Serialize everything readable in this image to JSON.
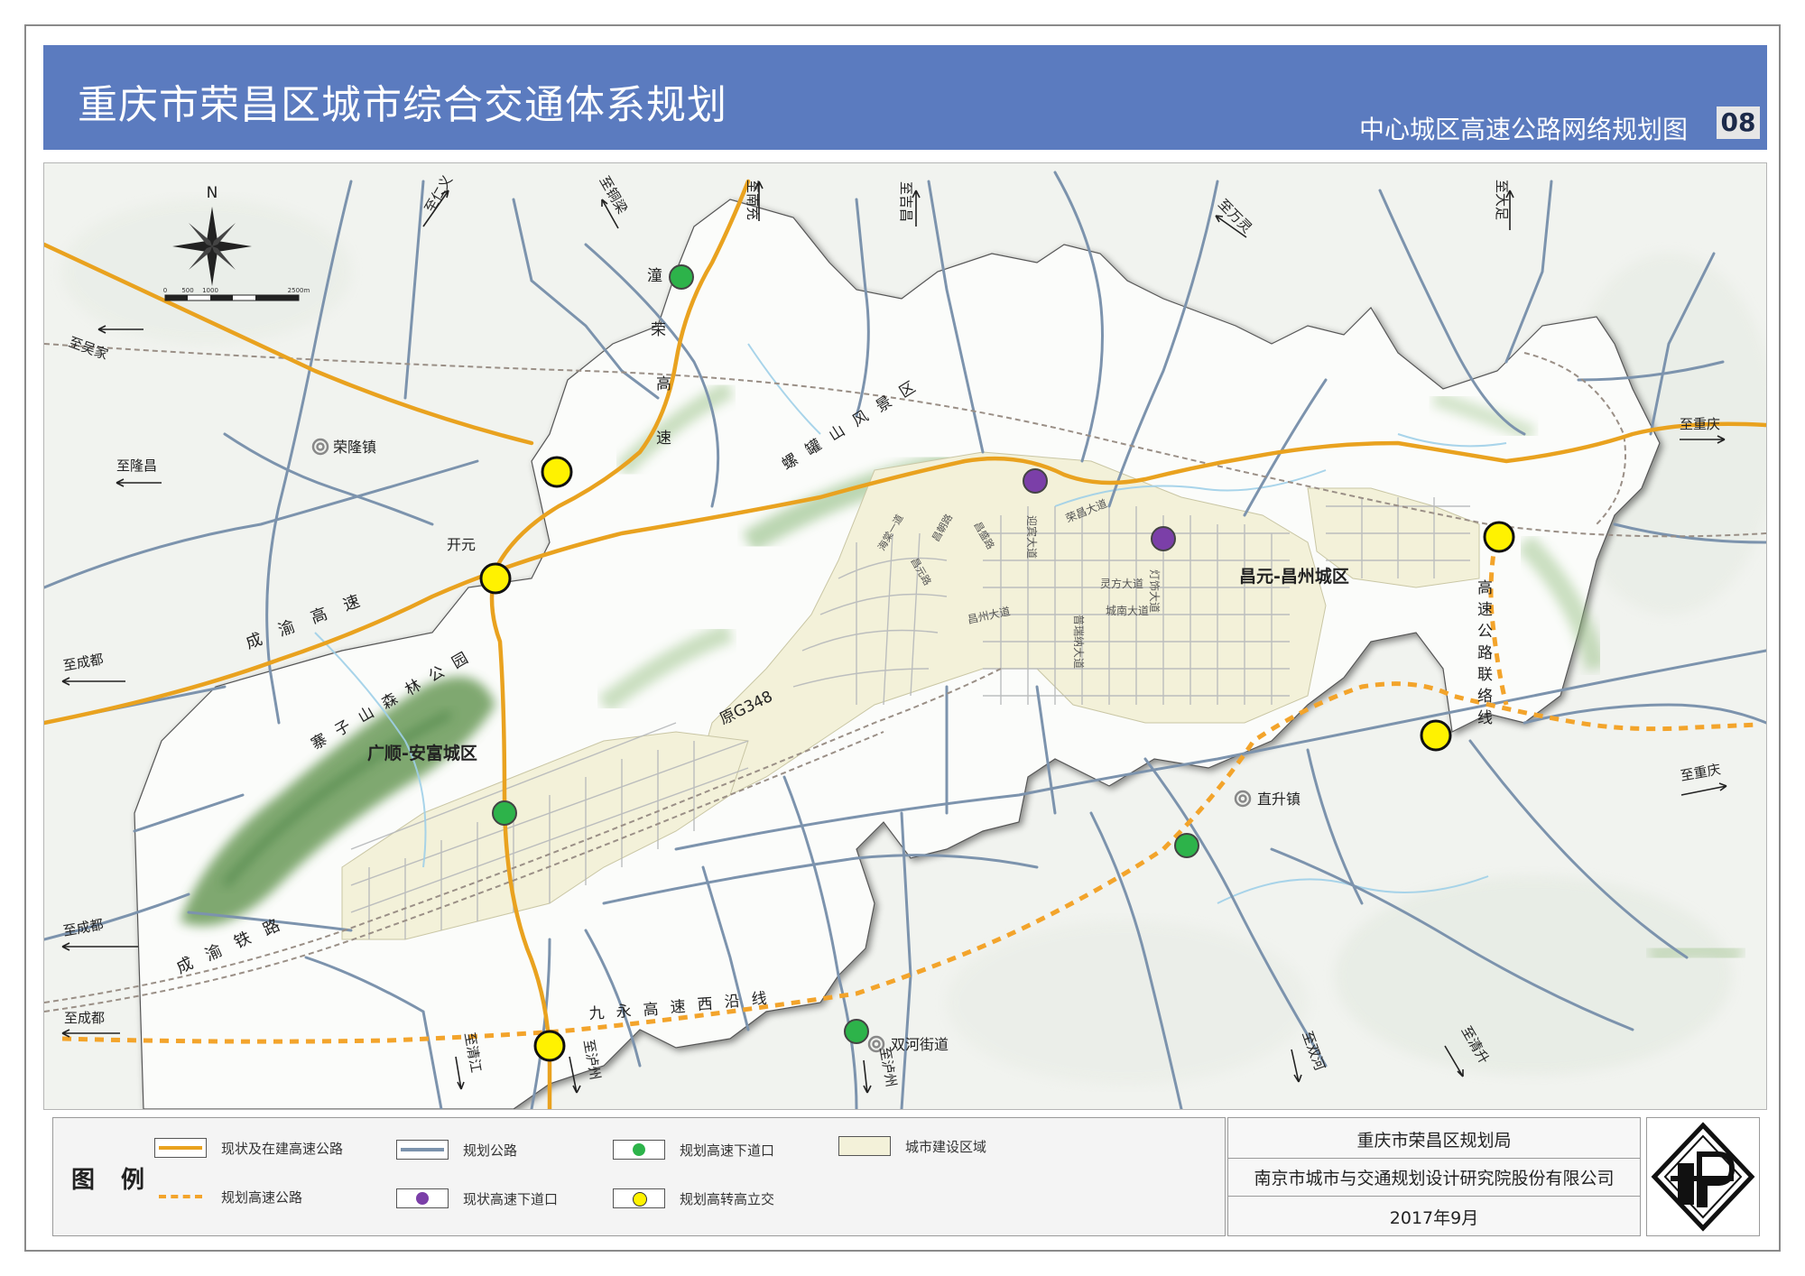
{
  "header": {
    "title": "重庆市荣昌区城市综合交通体系规划",
    "subtitle": "中心城区高速公路网络规划图",
    "sheet_number": "08"
  },
  "colors": {
    "header_bg": "#5b7bbf",
    "existing_expressway": "#e9a21f",
    "planned_expressway": "#f3a42b",
    "planned_road": "#7c93ad",
    "existing_interchange": "#7b3fa8",
    "planned_interchange": "#2db34a",
    "planned_hub_interchange": "#fff200",
    "urban_area": "#f3f1d9",
    "railway": "#9a8f86"
  },
  "map": {
    "compass_label": "N",
    "scale_labels": [
      "0",
      "500",
      "1000",
      "2500m"
    ],
    "directions": {
      "to_renyi": "至仁义",
      "to_tongliang": "至铜梁",
      "to_nanchong": "至南充",
      "to_jichang": "至吉昌",
      "to_wanling": "至万灵",
      "to_dazu": "至大足",
      "to_wujia": "至吴家",
      "to_longchang": "至隆昌",
      "to_chongqing_1": "至重庆",
      "to_chengdu_1": "至成都",
      "to_chongqing_2": "至重庆",
      "to_chengdu_2": "至成都",
      "to_chengdu_3": "至成都",
      "to_qingjiang": "至清江",
      "to_luzhou_1": "至泸州",
      "to_luzhou_2": "至泸州",
      "to_shuanghe": "至双河",
      "to_qinggang": "至清升"
    },
    "places": {
      "ronglong": "荣隆镇",
      "kaiyuan": "开元",
      "zhisheng": "直升镇",
      "shuanghe": "双河街道"
    },
    "districts": {
      "changyuan": "昌元-昌州城区",
      "guangshun": "广顺-安富城区"
    },
    "road_labels": {
      "tongrong": [
        "潼",
        "荣",
        "高",
        "速"
      ],
      "chengyu_exp": [
        "成",
        "渝",
        "高",
        "速"
      ],
      "chengyu_rail": [
        "成",
        "渝",
        "铁",
        "路"
      ],
      "jiuyong": [
        "九",
        "永",
        "高",
        "速",
        "西",
        "沿",
        "线"
      ],
      "link_line": [
        "高",
        "速",
        "公",
        "路",
        "联",
        "络",
        "线"
      ],
      "luoguan": [
        "螺",
        "罐",
        "山",
        "风",
        "景",
        "区"
      ],
      "zhaizi": [
        "寨",
        "子",
        "山",
        "森",
        "林",
        "公",
        "园"
      ],
      "g348": "原G348",
      "yingbin": "迎宾大道",
      "rongchang": "荣昌大道",
      "dengshi": "灯饰大道",
      "lingfang": "灵方大道",
      "chengnan": "城南大道",
      "puruina": "普瑞纳大道",
      "changzhou": "昌州大道",
      "haitang1": "海棠一道",
      "road_a": "昌朝路",
      "road_b": "昌元路",
      "road_c": "昌盛路"
    }
  },
  "legend": {
    "title": "图 例",
    "items": [
      {
        "label": "现状及在建高速公路"
      },
      {
        "label": "规划公路"
      },
      {
        "label": "规划高速下道口"
      },
      {
        "label": "城市建设区域"
      },
      {
        "label": "规划高速公路"
      },
      {
        "label": "现状高速下道口"
      },
      {
        "label": "规划高转高立交"
      }
    ]
  },
  "credits": {
    "org1": "重庆市荣昌区规划局",
    "org2": "南京市城市与交通规划设计研究院股份有限公司",
    "date": "2017年9月"
  }
}
